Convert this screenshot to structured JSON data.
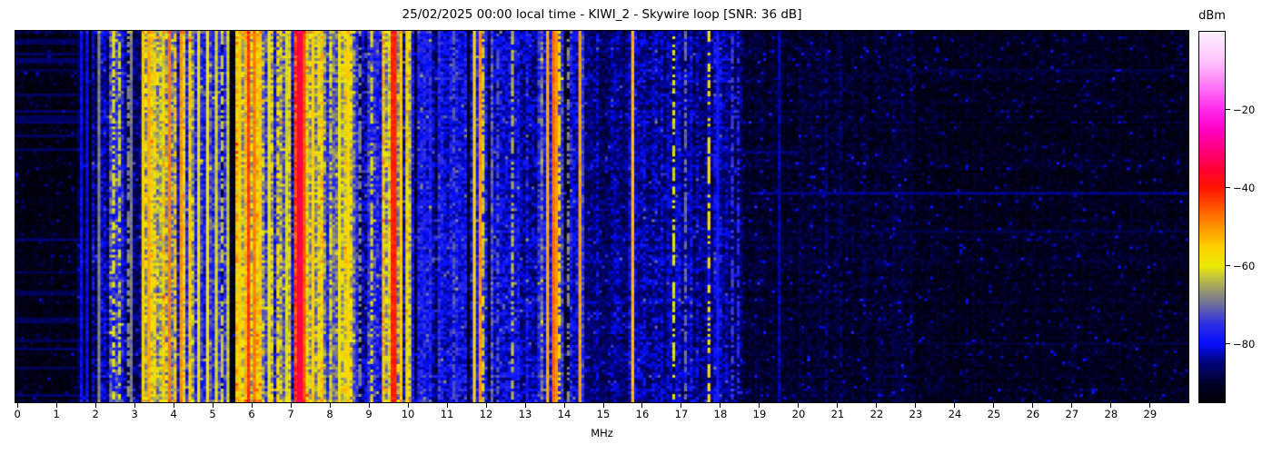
{
  "title": "25/02/2025 00:00 local time - KIWI_2 - Skywire loop [SNR: 36 dB]",
  "header": {
    "date_label": "25/02/2025",
    "time_label": "00:00 local time",
    "station": "KIWI_2",
    "antenna": "Skywire loop",
    "snr_label": "SNR: 36 dB"
  },
  "chart_data": {
    "type": "heatmap",
    "title": "25/02/2025 00:00 local time - KIWI_2 - Skywire loop [SNR: 36 dB]",
    "xlabel": "MHz",
    "x_range": [
      -0.05,
      29.98
    ],
    "x_ticks": [
      0,
      1,
      2,
      3,
      4,
      5,
      6,
      7,
      8,
      9,
      10,
      11,
      12,
      13,
      14,
      15,
      16,
      17,
      18,
      19,
      20,
      21,
      22,
      23,
      24,
      25,
      26,
      27,
      28,
      29
    ],
    "y_ticks": [],
    "grid": {
      "cols": 400,
      "rows": 136
    },
    "noise_seed": 1337,
    "colorbar": {
      "label": "dBm",
      "range_top_dbm": 0,
      "range_bottom_dbm": -95,
      "ticks": [
        {
          "value": -20,
          "label": "−20"
        },
        {
          "value": -40,
          "label": "−40"
        },
        {
          "value": -60,
          "label": "−60"
        },
        {
          "value": -80,
          "label": "−80"
        }
      ]
    },
    "colormap_stops": [
      [
        0.0,
        0,
        0,
        6
      ],
      [
        0.05,
        2,
        2,
        40
      ],
      [
        0.11,
        0,
        4,
        125
      ],
      [
        0.158,
        5,
        15,
        255
      ],
      [
        0.21,
        45,
        45,
        230
      ],
      [
        0.263,
        108,
        108,
        160
      ],
      [
        0.3,
        148,
        148,
        112
      ],
      [
        0.34,
        198,
        198,
        62
      ],
      [
        0.368,
        235,
        235,
        8
      ],
      [
        0.42,
        255,
        210,
        0
      ],
      [
        0.474,
        255,
        150,
        0
      ],
      [
        0.53,
        255,
        82,
        0
      ],
      [
        0.579,
        255,
        22,
        0
      ],
      [
        0.632,
        255,
        0,
        55
      ],
      [
        0.684,
        255,
        0,
        128
      ],
      [
        0.737,
        255,
        0,
        196
      ],
      [
        0.789,
        255,
        40,
        235
      ],
      [
        0.85,
        255,
        115,
        248
      ],
      [
        0.92,
        255,
        195,
        252
      ],
      [
        1.0,
        253,
        242,
        255
      ]
    ],
    "band_fields": [
      "f_start_mhz",
      "f_end_mhz",
      "base_dbm",
      "column_variation_db",
      "cell_noise_db"
    ],
    "bands": [
      [
        -0.05,
        1.55,
        -92.5,
        1.2,
        2.6
      ],
      [
        1.55,
        1.8,
        -87.0,
        3.0,
        4.0
      ],
      [
        1.8,
        2.35,
        -84.0,
        4.5,
        5.0
      ],
      [
        2.35,
        2.75,
        -76.0,
        6.0,
        6.0
      ],
      [
        2.75,
        3.18,
        -86.0,
        3.0,
        4.5
      ],
      [
        3.18,
        3.7,
        -66.0,
        7.0,
        7.0
      ],
      [
        3.7,
        4.55,
        -63.0,
        7.0,
        7.0
      ],
      [
        4.55,
        5.55,
        -78.0,
        7.0,
        6.0
      ],
      [
        5.55,
        6.35,
        -62.0,
        7.0,
        7.0
      ],
      [
        6.35,
        7.05,
        -70.0,
        8.0,
        7.0
      ],
      [
        7.05,
        7.38,
        -47.0,
        6.0,
        5.0
      ],
      [
        7.38,
        7.92,
        -63.0,
        7.0,
        7.0
      ],
      [
        7.92,
        8.17,
        -75.0,
        7.0,
        6.0
      ],
      [
        8.17,
        8.67,
        -64.0,
        7.0,
        7.0
      ],
      [
        8.67,
        9.33,
        -78.0,
        6.0,
        6.0
      ],
      [
        9.33,
        10.12,
        -61.0,
        7.0,
        7.0
      ],
      [
        10.12,
        11.45,
        -79.0,
        3.5,
        5.0
      ],
      [
        11.45,
        12.18,
        -77.0,
        4.5,
        5.5
      ],
      [
        12.18,
        13.35,
        -82.0,
        3.0,
        5.0
      ],
      [
        13.35,
        13.95,
        -75.0,
        5.0,
        6.0
      ],
      [
        13.95,
        14.38,
        -78.0,
        4.0,
        5.5
      ],
      [
        14.38,
        14.55,
        -73.0,
        4.0,
        5.0
      ],
      [
        14.55,
        15.62,
        -85.5,
        2.5,
        4.0
      ],
      [
        15.62,
        16.05,
        -83.0,
        3.0,
        4.5
      ],
      [
        16.05,
        18.55,
        -83.5,
        2.8,
        4.5
      ],
      [
        18.55,
        23.0,
        -90.0,
        1.2,
        3.2
      ],
      [
        23.0,
        29.98,
        -91.5,
        0.9,
        2.8
      ]
    ],
    "carrier_fields": [
      "f_mhz",
      "level_dbm",
      "width_cols",
      "dashed"
    ],
    "carriers": [
      [
        1.62,
        -80,
        1,
        0
      ],
      [
        1.76,
        -80,
        1,
        0
      ],
      [
        2.1,
        -68,
        1,
        0
      ],
      [
        2.5,
        -60,
        1,
        1
      ],
      [
        2.62,
        -62,
        1,
        1
      ],
      [
        2.82,
        -68,
        1,
        1
      ],
      [
        2.95,
        -69,
        1,
        0
      ],
      [
        3.25,
        -55,
        1,
        0
      ],
      [
        3.33,
        -52,
        1,
        0
      ],
      [
        3.5,
        -56,
        1,
        1
      ],
      [
        3.9,
        -48,
        1,
        0
      ],
      [
        4.07,
        -54,
        1,
        1
      ],
      [
        4.22,
        -50,
        1,
        0
      ],
      [
        4.38,
        -55,
        1,
        1
      ],
      [
        4.67,
        -60,
        1,
        0
      ],
      [
        4.86,
        -59,
        1,
        0
      ],
      [
        5.06,
        -61,
        1,
        0
      ],
      [
        5.25,
        -63,
        1,
        1
      ],
      [
        5.4,
        -62,
        1,
        0
      ],
      [
        5.68,
        -55,
        1,
        0
      ],
      [
        5.81,
        -52,
        1,
        1
      ],
      [
        5.93,
        -43,
        1,
        0
      ],
      [
        6.07,
        -48,
        1,
        0
      ],
      [
        6.19,
        -54,
        1,
        1
      ],
      [
        6.45,
        -59,
        1,
        0
      ],
      [
        6.68,
        -57,
        1,
        1
      ],
      [
        6.87,
        -61,
        1,
        0
      ],
      [
        7.21,
        -34,
        2,
        0
      ],
      [
        7.32,
        -45,
        1,
        0
      ],
      [
        7.55,
        -55,
        1,
        0
      ],
      [
        7.74,
        -57,
        1,
        1
      ],
      [
        8.0,
        -61,
        1,
        1
      ],
      [
        8.28,
        -58,
        1,
        0
      ],
      [
        8.46,
        -56,
        1,
        0
      ],
      [
        8.8,
        -68,
        1,
        1
      ],
      [
        9.1,
        -62,
        1,
        1
      ],
      [
        9.6,
        -41,
        2,
        0
      ],
      [
        9.82,
        -54,
        1,
        0
      ],
      [
        9.95,
        -58,
        1,
        1
      ],
      [
        10.55,
        -76,
        1,
        1
      ],
      [
        11.17,
        -72,
        1,
        1
      ],
      [
        11.72,
        -57,
        1,
        0
      ],
      [
        11.83,
        -50,
        1,
        0
      ],
      [
        11.95,
        -62,
        1,
        1
      ],
      [
        12.3,
        -72,
        1,
        1
      ],
      [
        12.7,
        -64,
        1,
        1
      ],
      [
        13.58,
        -52,
        1,
        0
      ],
      [
        13.69,
        -47,
        1,
        0
      ],
      [
        13.78,
        -50,
        1,
        0
      ],
      [
        13.87,
        -56,
        1,
        1
      ],
      [
        14.07,
        -68,
        1,
        1
      ],
      [
        14.37,
        -51,
        1,
        0
      ],
      [
        15.77,
        -53,
        1,
        0
      ],
      [
        16.77,
        -61,
        1,
        1
      ],
      [
        17.12,
        -70,
        1,
        1
      ],
      [
        17.74,
        -57,
        1,
        1
      ],
      [
        17.95,
        -78,
        1,
        0
      ],
      [
        18.3,
        -74,
        1,
        1
      ],
      [
        18.45,
        -76,
        1,
        1
      ],
      [
        19.5,
        -83,
        1,
        0
      ],
      [
        20.7,
        -85,
        1,
        1
      ],
      [
        21.05,
        -85,
        1,
        1
      ]
    ],
    "horizontal_lines": [
      {
        "row": 59,
        "f0": 18.8,
        "f1": 29.98,
        "level": -83.0
      },
      {
        "row": 44,
        "f0": 15.3,
        "f1": 20.0,
        "level": -84.5
      },
      {
        "row": 14,
        "f0": 23.0,
        "f1": 29.98,
        "level": -87.5
      },
      {
        "row": 73,
        "f0": 21.0,
        "f1": 29.98,
        "level": -88.0
      },
      {
        "row": 114,
        "f0": 22.5,
        "f1": 29.98,
        "level": -88.0
      }
    ],
    "left_region_row_lines": {
      "probability": 0.17,
      "f_max": 1.6,
      "level": -87.5
    },
    "edge_rows": {
      "top_boost_db": 5,
      "bottom_boost_db": 3.5,
      "f_max": 10.6
    },
    "speckle": {
      "probability": 0.055,
      "min_db": 4,
      "max_db": 10
    },
    "column_dropout": {
      "probability": 0.07,
      "min_db": 9,
      "max_db": 14
    }
  }
}
